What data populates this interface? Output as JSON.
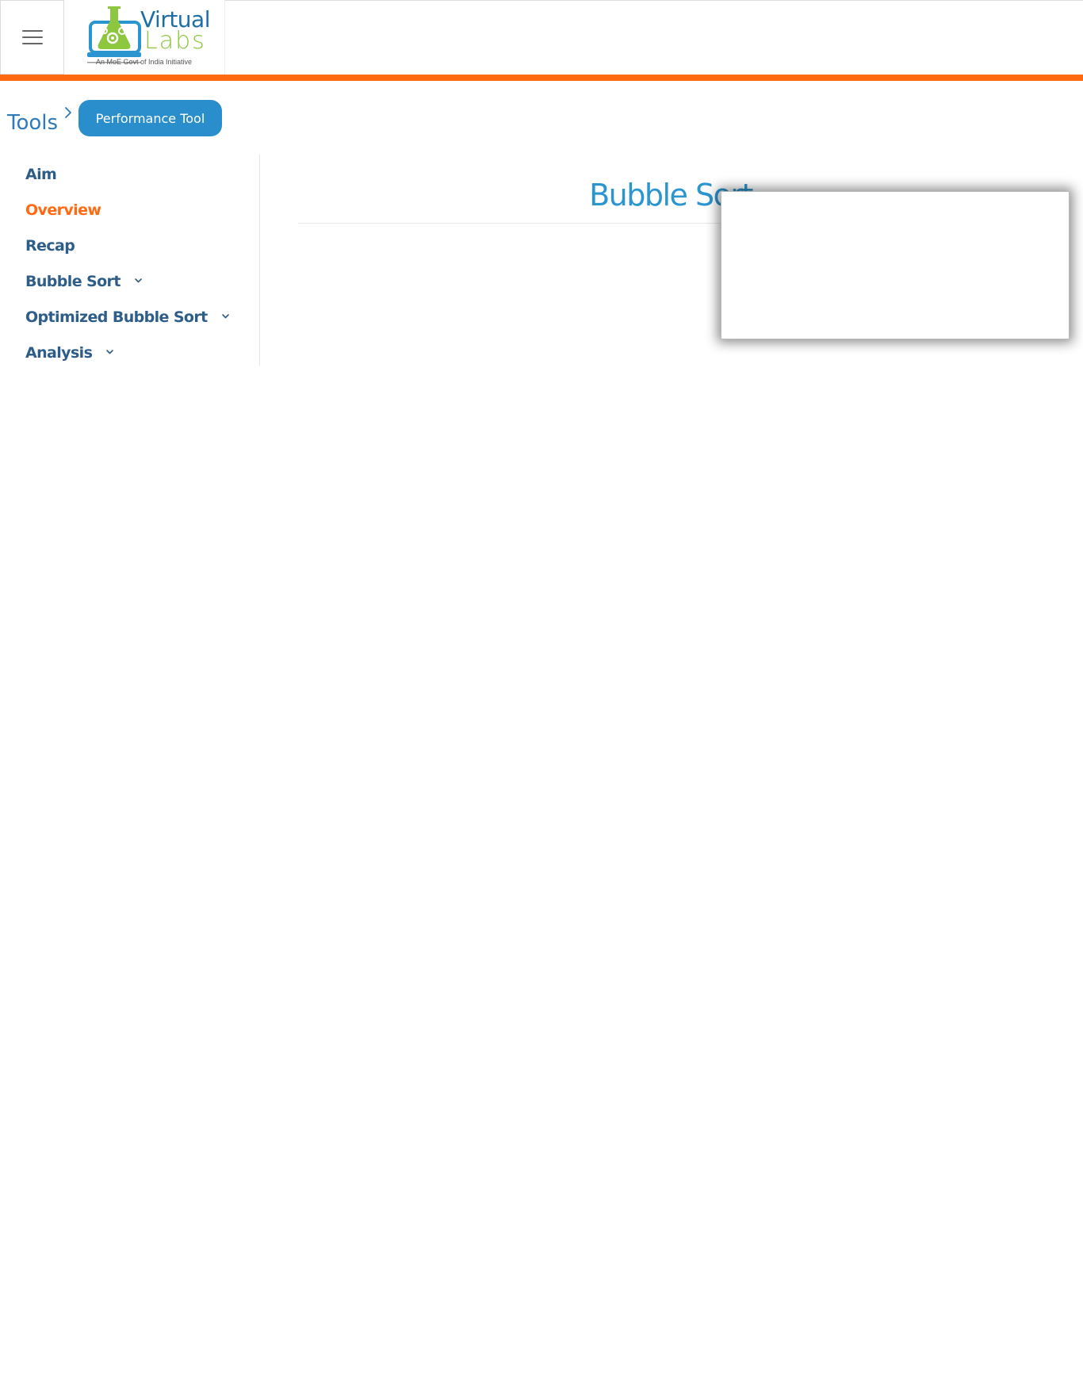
{
  "header": {
    "menu_icon": "hamburger-menu-icon",
    "logo": {
      "word_1": "Virtual",
      "word_2": "Labs",
      "tagline": "An MoE Govt of India Initiative"
    }
  },
  "breadcrumb": {
    "root": "Tools",
    "separator_icon": "chevron-right-icon",
    "current": "Performance Tool"
  },
  "sidebar": {
    "items": [
      {
        "label": "Aim",
        "active": false,
        "expandable": false
      },
      {
        "label": "Overview",
        "active": true,
        "expandable": false
      },
      {
        "label": "Recap",
        "active": false,
        "expandable": false
      },
      {
        "label": "Bubble Sort",
        "active": false,
        "expandable": true
      },
      {
        "label": "Optimized Bubble Sort",
        "active": false,
        "expandable": true
      },
      {
        "label": "Analysis",
        "active": false,
        "expandable": true
      }
    ]
  },
  "main": {
    "title": "Bubble Sort"
  },
  "colors": {
    "accent_orange": "#ff6a13",
    "nav_blue": "#2e5d8a",
    "title_blue": "#2b95cf",
    "button_blue": "#2a8ecd",
    "logo_blue": "#1b6fa5",
    "logo_green": "#8dc63f"
  }
}
